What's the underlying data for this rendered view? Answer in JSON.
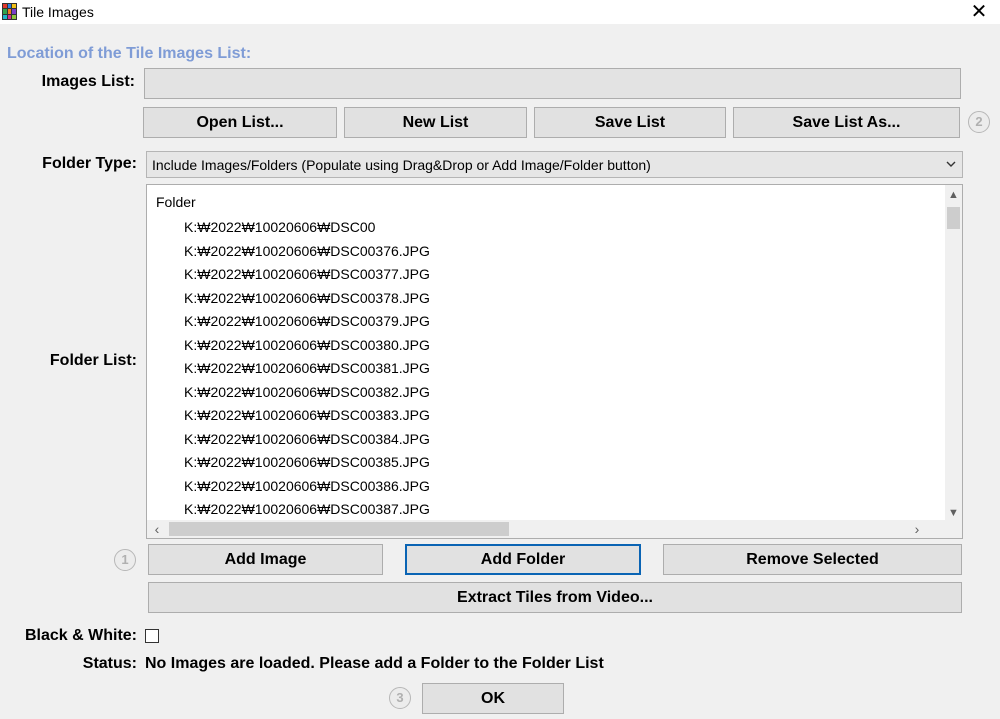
{
  "window": {
    "title": "Tile Images",
    "close_glyph": "✕"
  },
  "section": {
    "heading": "Location of the Tile Images List:"
  },
  "images_list": {
    "label": "Images List:",
    "value": ""
  },
  "list_buttons": {
    "open": "Open List...",
    "new": "New List",
    "save": "Save List",
    "save_as": "Save List As..."
  },
  "help_markers": {
    "list_buttons": "2",
    "folder_buttons": "1",
    "ok": "3"
  },
  "folder_type": {
    "label": "Folder Type:",
    "selected": "Include Images/Folders (Populate using Drag&Drop or Add Image/Folder button)"
  },
  "folder_list": {
    "label": "Folder List:",
    "header": "Folder",
    "items": [
      "K:₩2022₩10020606₩DSC00",
      "K:₩2022₩10020606₩DSC00376.JPG",
      "K:₩2022₩10020606₩DSC00377.JPG",
      "K:₩2022₩10020606₩DSC00378.JPG",
      "K:₩2022₩10020606₩DSC00379.JPG",
      "K:₩2022₩10020606₩DSC00380.JPG",
      "K:₩2022₩10020606₩DSC00381.JPG",
      "K:₩2022₩10020606₩DSC00382.JPG",
      "K:₩2022₩10020606₩DSC00383.JPG",
      "K:₩2022₩10020606₩DSC00384.JPG",
      "K:₩2022₩10020606₩DSC00385.JPG",
      "K:₩2022₩10020606₩DSC00386.JPG",
      "K:₩2022₩10020606₩DSC00387.JPG"
    ]
  },
  "folder_buttons": {
    "add_image": "Add Image",
    "add_folder": "Add Folder",
    "remove_selected": "Remove Selected",
    "extract_video": "Extract Tiles from Video..."
  },
  "black_white": {
    "label": "Black & White:",
    "checked": false
  },
  "status": {
    "label": "Status:",
    "text": "No Images are loaded. Please add a Folder to the Folder List"
  },
  "ok_button": {
    "label": "OK"
  },
  "colors": {
    "heading": "#7f9cd6",
    "focus_border": "#0a64b4",
    "dialog_bg": "#f0f0f0"
  }
}
